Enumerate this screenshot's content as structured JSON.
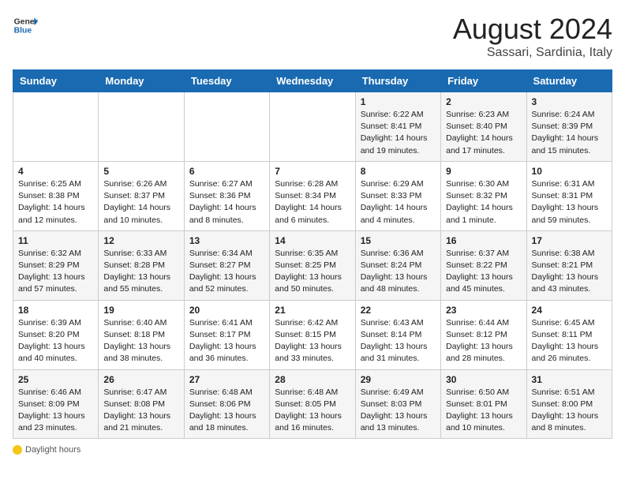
{
  "header": {
    "logo_line1": "General",
    "logo_line2": "Blue",
    "month_year": "August 2024",
    "location": "Sassari, Sardinia, Italy"
  },
  "footer": {
    "daylight_label": "Daylight hours"
  },
  "days_of_week": [
    "Sunday",
    "Monday",
    "Tuesday",
    "Wednesday",
    "Thursday",
    "Friday",
    "Saturday"
  ],
  "weeks": [
    [
      {
        "day": "",
        "info": ""
      },
      {
        "day": "",
        "info": ""
      },
      {
        "day": "",
        "info": ""
      },
      {
        "day": "",
        "info": ""
      },
      {
        "day": "1",
        "info": "Sunrise: 6:22 AM\nSunset: 8:41 PM\nDaylight: 14 hours and 19 minutes."
      },
      {
        "day": "2",
        "info": "Sunrise: 6:23 AM\nSunset: 8:40 PM\nDaylight: 14 hours and 17 minutes."
      },
      {
        "day": "3",
        "info": "Sunrise: 6:24 AM\nSunset: 8:39 PM\nDaylight: 14 hours and 15 minutes."
      }
    ],
    [
      {
        "day": "4",
        "info": "Sunrise: 6:25 AM\nSunset: 8:38 PM\nDaylight: 14 hours and 12 minutes."
      },
      {
        "day": "5",
        "info": "Sunrise: 6:26 AM\nSunset: 8:37 PM\nDaylight: 14 hours and 10 minutes."
      },
      {
        "day": "6",
        "info": "Sunrise: 6:27 AM\nSunset: 8:36 PM\nDaylight: 14 hours and 8 minutes."
      },
      {
        "day": "7",
        "info": "Sunrise: 6:28 AM\nSunset: 8:34 PM\nDaylight: 14 hours and 6 minutes."
      },
      {
        "day": "8",
        "info": "Sunrise: 6:29 AM\nSunset: 8:33 PM\nDaylight: 14 hours and 4 minutes."
      },
      {
        "day": "9",
        "info": "Sunrise: 6:30 AM\nSunset: 8:32 PM\nDaylight: 14 hours and 1 minute."
      },
      {
        "day": "10",
        "info": "Sunrise: 6:31 AM\nSunset: 8:31 PM\nDaylight: 13 hours and 59 minutes."
      }
    ],
    [
      {
        "day": "11",
        "info": "Sunrise: 6:32 AM\nSunset: 8:29 PM\nDaylight: 13 hours and 57 minutes."
      },
      {
        "day": "12",
        "info": "Sunrise: 6:33 AM\nSunset: 8:28 PM\nDaylight: 13 hours and 55 minutes."
      },
      {
        "day": "13",
        "info": "Sunrise: 6:34 AM\nSunset: 8:27 PM\nDaylight: 13 hours and 52 minutes."
      },
      {
        "day": "14",
        "info": "Sunrise: 6:35 AM\nSunset: 8:25 PM\nDaylight: 13 hours and 50 minutes."
      },
      {
        "day": "15",
        "info": "Sunrise: 6:36 AM\nSunset: 8:24 PM\nDaylight: 13 hours and 48 minutes."
      },
      {
        "day": "16",
        "info": "Sunrise: 6:37 AM\nSunset: 8:22 PM\nDaylight: 13 hours and 45 minutes."
      },
      {
        "day": "17",
        "info": "Sunrise: 6:38 AM\nSunset: 8:21 PM\nDaylight: 13 hours and 43 minutes."
      }
    ],
    [
      {
        "day": "18",
        "info": "Sunrise: 6:39 AM\nSunset: 8:20 PM\nDaylight: 13 hours and 40 minutes."
      },
      {
        "day": "19",
        "info": "Sunrise: 6:40 AM\nSunset: 8:18 PM\nDaylight: 13 hours and 38 minutes."
      },
      {
        "day": "20",
        "info": "Sunrise: 6:41 AM\nSunset: 8:17 PM\nDaylight: 13 hours and 36 minutes."
      },
      {
        "day": "21",
        "info": "Sunrise: 6:42 AM\nSunset: 8:15 PM\nDaylight: 13 hours and 33 minutes."
      },
      {
        "day": "22",
        "info": "Sunrise: 6:43 AM\nSunset: 8:14 PM\nDaylight: 13 hours and 31 minutes."
      },
      {
        "day": "23",
        "info": "Sunrise: 6:44 AM\nSunset: 8:12 PM\nDaylight: 13 hours and 28 minutes."
      },
      {
        "day": "24",
        "info": "Sunrise: 6:45 AM\nSunset: 8:11 PM\nDaylight: 13 hours and 26 minutes."
      }
    ],
    [
      {
        "day": "25",
        "info": "Sunrise: 6:46 AM\nSunset: 8:09 PM\nDaylight: 13 hours and 23 minutes."
      },
      {
        "day": "26",
        "info": "Sunrise: 6:47 AM\nSunset: 8:08 PM\nDaylight: 13 hours and 21 minutes."
      },
      {
        "day": "27",
        "info": "Sunrise: 6:48 AM\nSunset: 8:06 PM\nDaylight: 13 hours and 18 minutes."
      },
      {
        "day": "28",
        "info": "Sunrise: 6:48 AM\nSunset: 8:05 PM\nDaylight: 13 hours and 16 minutes."
      },
      {
        "day": "29",
        "info": "Sunrise: 6:49 AM\nSunset: 8:03 PM\nDaylight: 13 hours and 13 minutes."
      },
      {
        "day": "30",
        "info": "Sunrise: 6:50 AM\nSunset: 8:01 PM\nDaylight: 13 hours and 10 minutes."
      },
      {
        "day": "31",
        "info": "Sunrise: 6:51 AM\nSunset: 8:00 PM\nDaylight: 13 hours and 8 minutes."
      }
    ]
  ]
}
